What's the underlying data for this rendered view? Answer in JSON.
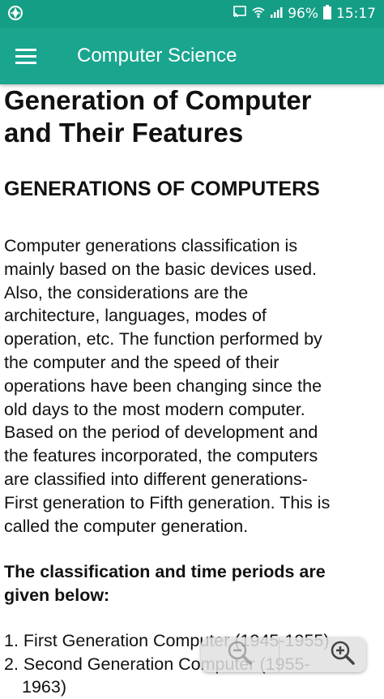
{
  "status_bar": {
    "battery": "96%",
    "time": "15:17",
    "icons": [
      "app-notification-icon",
      "cast-icon",
      "wifi-icon",
      "signal-icon",
      "battery-icon"
    ]
  },
  "app_bar": {
    "title": "Computer Science",
    "menu_icon": "hamburger-menu-icon"
  },
  "article": {
    "title_line1": "Generation of Computer",
    "title_line2": "and Their Features",
    "section_heading": "GENERATIONS OF COMPUTERS",
    "paragraph": [
      "Computer generations classification is",
      "mainly based on the basic devices used.",
      "Also, the considerations are the",
      "architecture, languages, modes of",
      "operation, etc. The function performed by",
      "the computer and the speed of their",
      "operations have been changing since the",
      "old days to the most modern computer.",
      "Based on the period of development and",
      "the features incorporated, the computers",
      "are classified into different generations-",
      "First generation to Fifth generation. This is",
      "called the computer generation."
    ],
    "subheading_line1": "The classification and time periods are",
    "subheading_line2": "given below:",
    "list": [
      "1. First Generation Computer (1945-1955)",
      "2. Second Generation Computer (1955-",
      "1963)"
    ]
  },
  "zoom_control": {
    "zoom_out_icon": "zoom-out-icon",
    "zoom_in_icon": "zoom-in-icon"
  },
  "colors": {
    "status_bar": "#159e86",
    "app_bar": "#1aa58e",
    "text": "#111111"
  }
}
